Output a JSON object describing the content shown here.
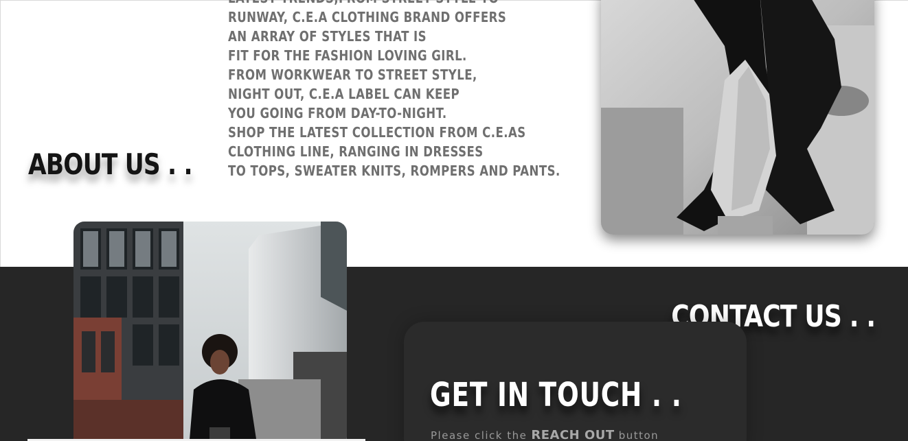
{
  "about": {
    "title": "ABOUT US . .",
    "paragraph_lines": [
      "LATEST TRENDS,FROM STREET STYLE TO",
      "RUNWAY, C.E.A CLOTHING BRAND OFFERS",
      "AN ARRAY OF STYLES THAT IS",
      "FIT FOR THE FASHION LOVING GIRL.",
      "FROM WORKWEAR TO STREET STYLE,",
      "NIGHT OUT, C.E.A LABEL CAN KEEP",
      "YOU GOING FROM DAY-TO-NIGHT.",
      "SHOP THE LATEST COLLECTION FROM C.E.AS",
      "CLOTHING LINE, RANGING IN DRESSES",
      "TO TOPS, SWEATER KNITS, ROMPERS AND PANTS."
    ],
    "photo_icon": "fashion-photo-black-and-white"
  },
  "contact": {
    "title": "CONTACT US . .",
    "card": {
      "title": "GET IN TOUCH . .",
      "hint_prefix": "Please click the",
      "hint_emphasis": "REACH OUT",
      "hint_suffix": "button"
    },
    "photo_icon": "street-fashion-photo"
  },
  "colors": {
    "dark_section": "#262626",
    "card": "#2b2b2b",
    "about_text": "#6f6f6f",
    "heading_dark": "#141414",
    "heading_light": "#ffffff"
  }
}
